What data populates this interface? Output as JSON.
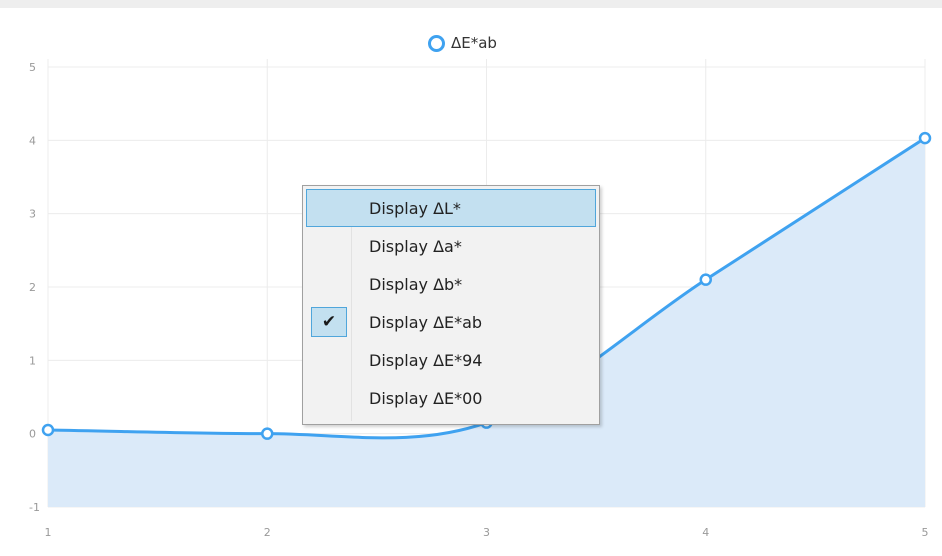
{
  "legend": {
    "label": "ΔE*ab"
  },
  "colors": {
    "line": "#3fa2f0",
    "area": "#dbeaf9",
    "grid": "#ececec",
    "tick": "#999999"
  },
  "chart_data": {
    "type": "area",
    "series": [
      {
        "name": "ΔE*ab",
        "x": [
          1,
          2,
          3,
          4,
          5
        ],
        "values": [
          0.05,
          0.0,
          0.15,
          2.1,
          4.03
        ]
      }
    ],
    "xlim": [
      1,
      5
    ],
    "ylim": [
      -1,
      5
    ],
    "x_ticks": [
      "1",
      "2",
      "3",
      "4",
      "5"
    ],
    "y_ticks": [
      "-1",
      "0",
      "1",
      "2",
      "3",
      "4",
      "5"
    ],
    "grid": true,
    "smooth": true,
    "legend_position": "top-center"
  },
  "context_menu": {
    "items": [
      {
        "label": "Display ΔL*",
        "checked": false,
        "highlighted": true
      },
      {
        "label": "Display Δa*",
        "checked": false,
        "highlighted": false
      },
      {
        "label": "Display Δb*",
        "checked": false,
        "highlighted": false
      },
      {
        "label": "Display ΔE*ab",
        "checked": true,
        "highlighted": false
      },
      {
        "label": "Display ΔE*94",
        "checked": false,
        "highlighted": false
      },
      {
        "label": "Display ΔE*00",
        "checked": false,
        "highlighted": false
      }
    ],
    "check_glyph": "✔"
  }
}
